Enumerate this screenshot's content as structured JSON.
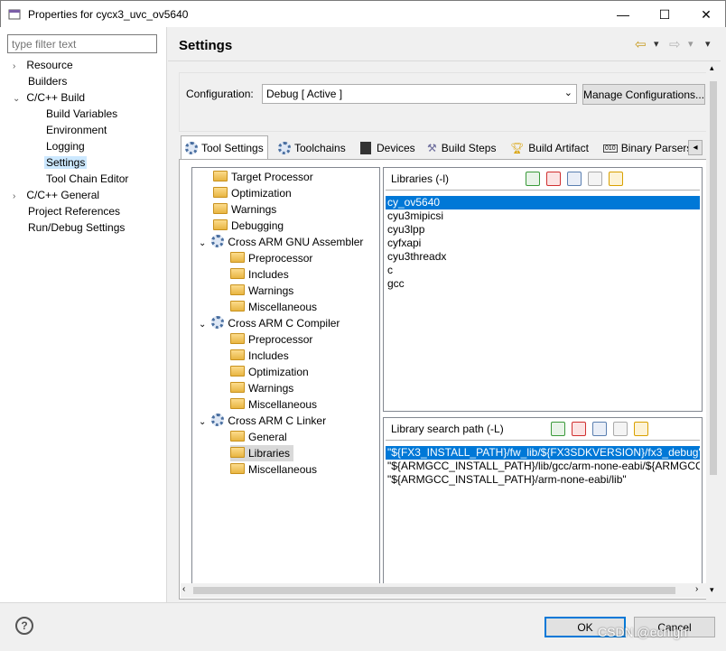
{
  "window": {
    "title": "Properties for cycx3_uvc_ov5640",
    "minimize": "—",
    "maximize": "☐",
    "close": "✕"
  },
  "nav": {
    "filter_placeholder": "type filter text",
    "items": [
      {
        "label": "Resource",
        "twisty": "›"
      },
      {
        "label": "Builders",
        "twisty": ""
      },
      {
        "label": "C/C++ Build",
        "twisty": "⌄"
      },
      {
        "label": "Build Variables",
        "twisty": ""
      },
      {
        "label": "Environment",
        "twisty": ""
      },
      {
        "label": "Logging",
        "twisty": ""
      },
      {
        "label": "Settings",
        "twisty": ""
      },
      {
        "label": "Tool Chain Editor",
        "twisty": ""
      },
      {
        "label": "C/C++ General",
        "twisty": "›"
      },
      {
        "label": "Project References",
        "twisty": ""
      },
      {
        "label": "Run/Debug Settings",
        "twisty": ""
      }
    ]
  },
  "header": {
    "title": "Settings",
    "back_icon": "⇦",
    "forward_icon": "⇨",
    "menu_icon": "▾"
  },
  "config": {
    "label": "Configuration:",
    "value": "Debug  [ Active ]",
    "manage_button": "Manage Configurations..."
  },
  "tabs": [
    {
      "label": "Tool Settings"
    },
    {
      "label": "Toolchains"
    },
    {
      "label": "Devices"
    },
    {
      "label": "Build Steps"
    },
    {
      "label": "Build Artifact"
    },
    {
      "label": "Binary Parsers"
    }
  ],
  "tree": [
    {
      "label": "Target Processor"
    },
    {
      "label": "Optimization"
    },
    {
      "label": "Warnings"
    },
    {
      "label": "Debugging"
    },
    {
      "label": "Cross ARM GNU Assembler"
    },
    {
      "label": "Preprocessor"
    },
    {
      "label": "Includes"
    },
    {
      "label": "Warnings"
    },
    {
      "label": "Miscellaneous"
    },
    {
      "label": "Cross ARM C Compiler"
    },
    {
      "label": "Preprocessor"
    },
    {
      "label": "Includes"
    },
    {
      "label": "Optimization"
    },
    {
      "label": "Warnings"
    },
    {
      "label": "Miscellaneous"
    },
    {
      "label": "Cross ARM C Linker"
    },
    {
      "label": "General"
    },
    {
      "label": "Libraries"
    },
    {
      "label": "Miscellaneous"
    }
  ],
  "libraries": {
    "title": "Libraries (-l)",
    "items": [
      "cy_ov5640",
      "cyu3mipicsi",
      "cyu3lpp",
      "cyfxapi",
      "cyu3threadx",
      "c",
      "gcc"
    ]
  },
  "search_path": {
    "title": "Library search path (-L)",
    "items": [
      "\"${FX3_INSTALL_PATH}/fw_lib/${FX3SDKVERSION}/fx3_debug\"",
      "\"${ARMGCC_INSTALL_PATH}/lib/gcc/arm-none-eabi/${ARMGCC_VERSION}\"",
      "\"${ARMGCC_INSTALL_PATH}/arm-none-eabi/lib\""
    ]
  },
  "footer": {
    "help_icon": "?",
    "ok": "OK",
    "cancel": "Cancel",
    "watermark": "CSDN @echigh"
  }
}
